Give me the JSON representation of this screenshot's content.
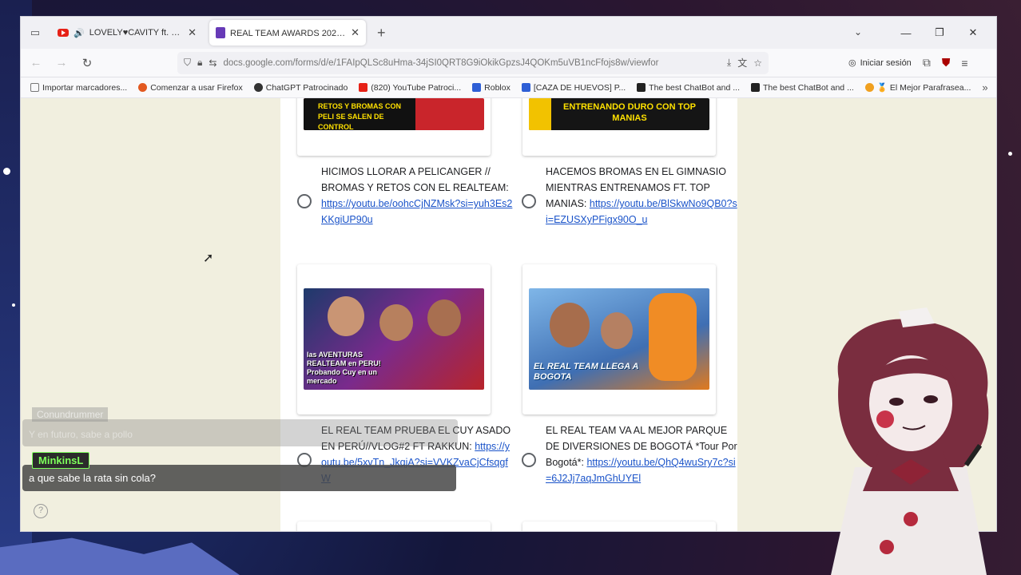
{
  "browser": {
    "tabs": [
      {
        "title": "LOVELY♥CAVITY ft. Hatsune",
        "favicon": "youtube-icon",
        "audio": true
      },
      {
        "title": "REAL TEAM AWARDS 2025 🏆",
        "favicon": "google-forms-icon",
        "active": true
      }
    ],
    "url": "docs.google.com/forms/d/e/1FAIpQLSc8uHma-34jSI0QRT8G9iOkikGpzsJ4QOKm5uVB1ncFfojs8w/viewfor",
    "signin_label": "Iniciar sesión",
    "bookmarks": [
      "Importar marcadores...",
      "Comenzar a usar Firefox",
      "ChatGPT Patrocinado",
      "(820) YouTube Patroci...",
      "Roblox",
      "[CAZA DE HUEVOS] P...",
      "The best ChatBot and ...",
      "The best ChatBot and ...",
      "🏅 El Mejor Parafrasea..."
    ]
  },
  "form": {
    "thumb_captions": {
      "top_left": "RETOS Y BROMAS CON PELI SE SALEN DE CONTROL",
      "top_right": "ENTRENANDO DURO CON TOP MANIAS",
      "mid_left": "las AVENTURAS REALTEAM en PERU! Probando Cuy en un mercado",
      "mid_right": "EL REAL TEAM LLEGA A BOGOTA"
    },
    "options": [
      {
        "text": "HICIMOS LLORAR A PELICANGER // BROMAS Y RETOS CON EL REALTEAM: ",
        "link": "https://youtu.be/oohcCjNZMsk?si=yuh3Es2KKgiUP90u"
      },
      {
        "text": "HACEMOS BROMAS EN EL GIMNASIO MIENTRAS ENTRENAMOS FT. TOP MANIAS: ",
        "link": "https://youtu.be/BlSkwNo9QB0?si=EZUSXyPFigx90O_u"
      },
      {
        "text": "EL REAL TEAM PRUEBA EL CUY ASADO EN PERÚ//VLOG#2 FT RAKKUN: ",
        "link": "https://youtu.be/5xvTn_JkqjA?si=VVKZvaCjCfsqgfW"
      },
      {
        "text": "EL REAL TEAM VA AL MEJOR PARQUE DE DIVERSIONES DE BOGOTÁ *Tour Por Bogotá*: ",
        "link": "https://youtu.be/QhQ4wuSry7c?si=6J2Jj7aqJmGhUYEl"
      }
    ]
  },
  "chat": {
    "ghost_user": "Conundrummer",
    "ghost_message": "Y en futuro, sabe a pollo",
    "user": "MinkinsL",
    "message": "a que sabe la rata sin cola?"
  },
  "colors": {
    "accent": "#673ab7",
    "page_bg": "#f1efdf",
    "link": "#1a53c9",
    "chat_name": "#7dff5b"
  }
}
